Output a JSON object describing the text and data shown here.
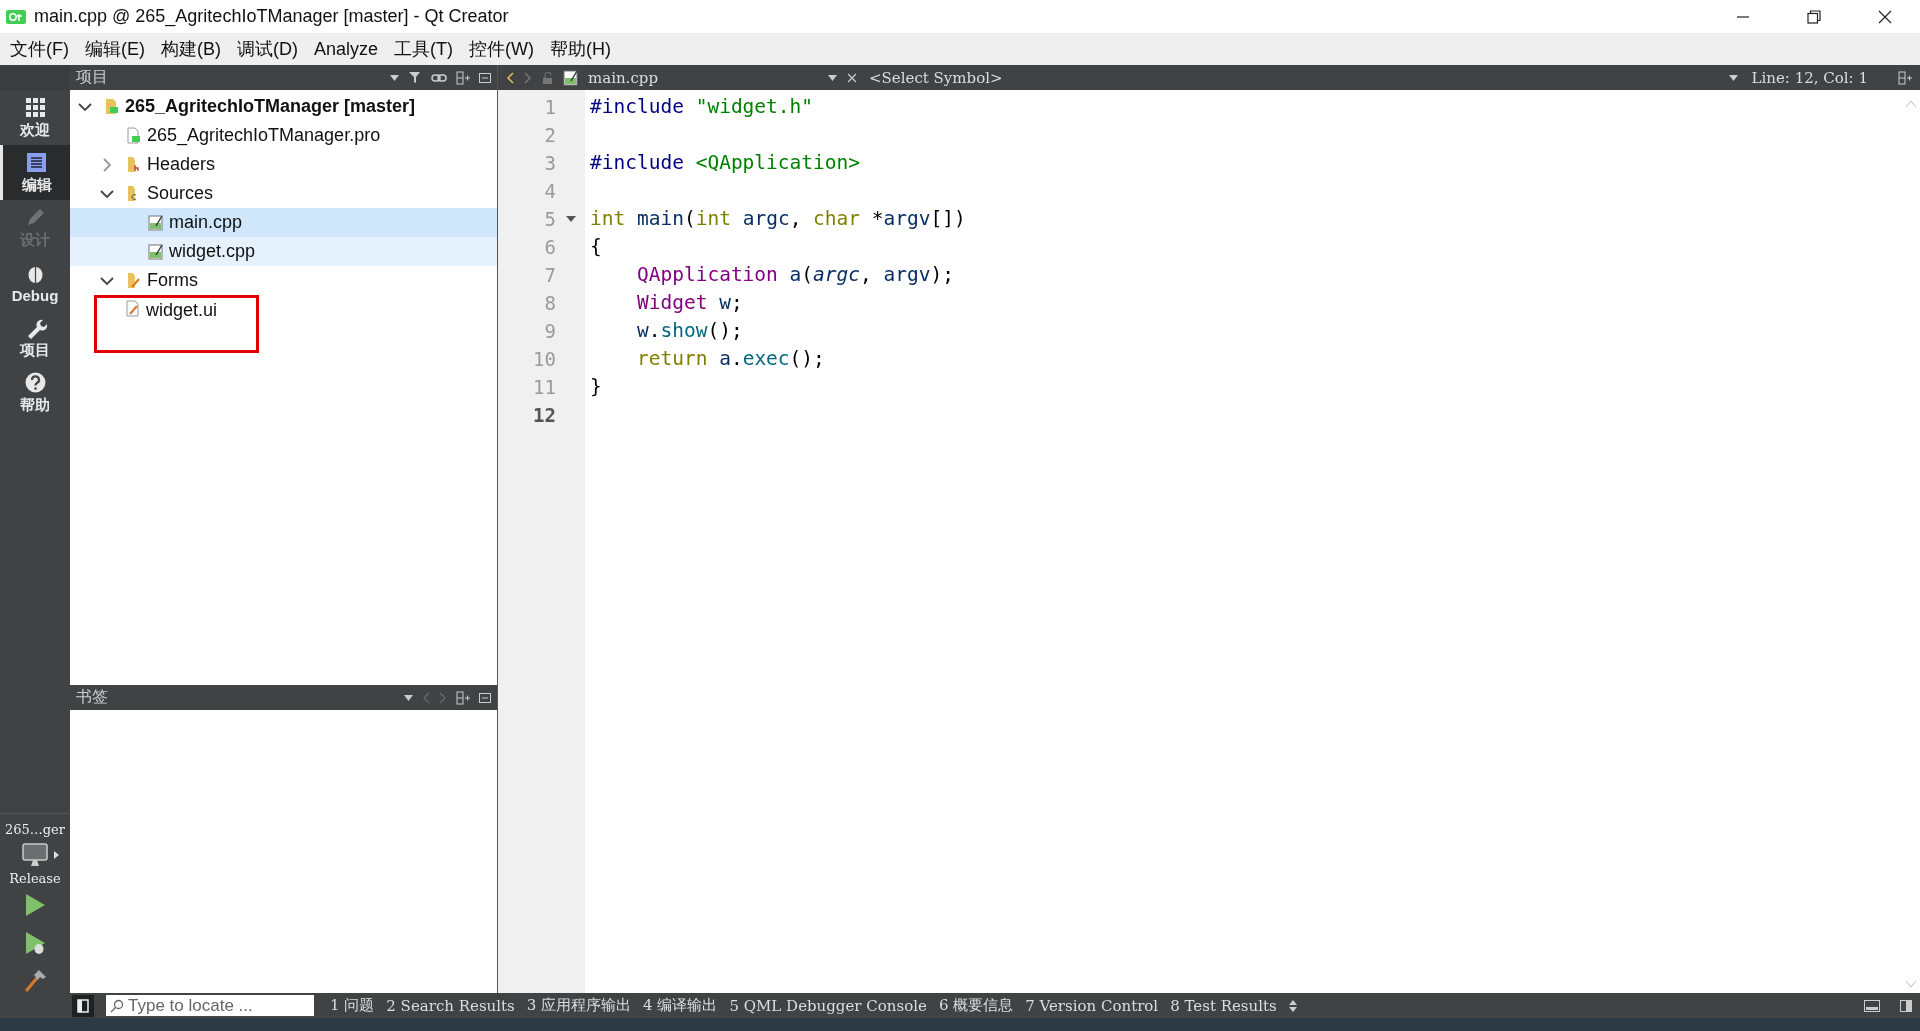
{
  "window": {
    "title": "main.cpp @ 265_AgritechIoTManager [master] - Qt Creator"
  },
  "menu": [
    "文件(F)",
    "编辑(E)",
    "构建(B)",
    "调试(D)",
    "Analyze",
    "工具(T)",
    "控件(W)",
    "帮助(H)"
  ],
  "modes": [
    {
      "label": "欢迎",
      "kind": "grid",
      "selected": false,
      "disabled": false
    },
    {
      "label": "编辑",
      "kind": "edit",
      "selected": true,
      "disabled": false
    },
    {
      "label": "设计",
      "kind": "pencil",
      "selected": false,
      "disabled": true
    },
    {
      "label": "Debug",
      "kind": "bug",
      "selected": false,
      "disabled": false
    },
    {
      "label": "项目",
      "kind": "wrench",
      "selected": false,
      "disabled": false
    },
    {
      "label": "帮助",
      "kind": "help",
      "selected": false,
      "disabled": false
    }
  ],
  "kit": {
    "project": "265…ger",
    "config": "Release"
  },
  "project_pane": {
    "title": "项目",
    "tree": [
      {
        "label": "265_AgritechIoTManager [master]",
        "kind": "project",
        "expanded": true,
        "children": [
          {
            "label": "265_AgritechIoTManager.pro",
            "kind": "pro"
          },
          {
            "label": "Headers",
            "kind": "folder-h",
            "expanded": false
          },
          {
            "label": "Sources",
            "kind": "folder-cpp",
            "expanded": true,
            "children": [
              {
                "label": "main.cpp",
                "kind": "cpp",
                "selected": true,
                "hovered": false
              },
              {
                "label": "widget.cpp",
                "kind": "cpp",
                "selected": false,
                "hovered": true
              }
            ]
          },
          {
            "label": "Forms",
            "kind": "folder-ui",
            "expanded": true,
            "children": [
              {
                "label": "widget.ui",
                "kind": "ui",
                "selected": false,
                "hovered": false,
                "outlined": true
              }
            ]
          }
        ]
      }
    ]
  },
  "bookmarks_pane": {
    "title": "书签"
  },
  "editor": {
    "file": "main.cpp",
    "symbol": "<Select Symbol>",
    "position": "Line: 12, Col: 1",
    "lines": [
      {
        "number": "1",
        "tokens": [
          {
            "kind": "preproc",
            "text": "#include"
          },
          {
            "kind": "string",
            "text": " \"widget.h\""
          }
        ]
      },
      {
        "number": "2"
      },
      {
        "number": "3",
        "tokens": [
          {
            "kind": "preproc",
            "text": "#include"
          },
          {
            "kind": "string",
            "text": " <QApplication>"
          }
        ]
      },
      {
        "number": "4"
      },
      {
        "number": "5",
        "foldable": true,
        "tokens": [
          {
            "kind": "keyword",
            "text": "int"
          },
          {
            "kind": "name",
            "text": " main"
          },
          {
            "kind": "plain",
            "text": "("
          },
          {
            "kind": "keyword",
            "text": "int"
          },
          {
            "kind": "name",
            "text": " argc"
          },
          {
            "kind": "plain",
            "text": ","
          },
          {
            "kind": "keyword",
            "text": " char"
          },
          {
            "kind": "plain",
            "text": " *"
          },
          {
            "kind": "name",
            "text": "argv"
          },
          {
            "kind": "plain",
            "text": "[])"
          }
        ]
      },
      {
        "number": "6",
        "tokens": [
          {
            "kind": "plain",
            "text": "{"
          }
        ]
      },
      {
        "number": "7",
        "tokens": [
          {
            "kind": "type",
            "text": "    QApplication"
          },
          {
            "kind": "name",
            "text": " a"
          },
          {
            "kind": "plain",
            "text": "("
          },
          {
            "kind": "param",
            "text": "argc"
          },
          {
            "kind": "plain",
            "text": ","
          },
          {
            "kind": "name",
            "text": " argv"
          },
          {
            "kind": "plain",
            "text": ");"
          }
        ]
      },
      {
        "number": "8",
        "tokens": [
          {
            "kind": "type",
            "text": "    Widget"
          },
          {
            "kind": "name",
            "text": " w"
          },
          {
            "kind": "plain",
            "text": ";"
          }
        ]
      },
      {
        "number": "9",
        "tokens": [
          {
            "kind": "name",
            "text": "    w"
          },
          {
            "kind": "plain",
            "text": "."
          },
          {
            "kind": "method",
            "text": "show"
          },
          {
            "kind": "plain",
            "text": "();"
          }
        ]
      },
      {
        "number": "10",
        "tokens": [
          {
            "kind": "keyword",
            "text": "    return"
          },
          {
            "kind": "name",
            "text": " a"
          },
          {
            "kind": "plain",
            "text": "."
          },
          {
            "kind": "method",
            "text": "exec"
          },
          {
            "kind": "plain",
            "text": "();"
          }
        ]
      },
      {
        "number": "11",
        "tokens": [
          {
            "kind": "plain",
            "text": "}"
          }
        ]
      },
      {
        "number": "12",
        "current": true
      }
    ]
  },
  "status_bar": {
    "locate_placeholder": "Type to locate ...",
    "panes": [
      "1 问题",
      "2 Search Results",
      "3 应用程序输出",
      "4 编译输出",
      "5 QML Debugger Console",
      "6 概要信息",
      "7 Version Control",
      "8 Test Results"
    ]
  }
}
